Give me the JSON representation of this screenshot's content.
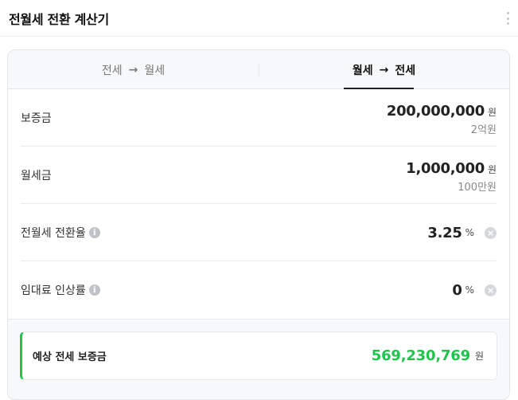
{
  "header": {
    "title": "전월세 전환 계산기",
    "more_icon": "more-vertical-icon"
  },
  "tabs": [
    {
      "from": "전세",
      "arrow": "→",
      "to": "월세",
      "active": false
    },
    {
      "from": "월세",
      "arrow": "→",
      "to": "전세",
      "active": true
    }
  ],
  "fields": {
    "deposit": {
      "label": "보증금",
      "value": "200,000,000",
      "unit": "원",
      "sub": "2억원"
    },
    "monthly_rent": {
      "label": "월세금",
      "value": "1,000,000",
      "unit": "원",
      "sub": "100만원"
    },
    "conversion_rate": {
      "label": "전월세 전환율",
      "value": "3.25",
      "unit": "%",
      "info_icon": "i",
      "clear_icon": "×"
    },
    "rent_increase_rate": {
      "label": "임대료 인상률",
      "value": "0",
      "unit": "%",
      "info_icon": "i",
      "clear_icon": "×"
    }
  },
  "result": {
    "label": "예상 전세 보증금",
    "value": "569,230,769",
    "unit": "원"
  },
  "colors": {
    "accent": "#1ec44b",
    "tab_bg": "#f7f8fa"
  }
}
